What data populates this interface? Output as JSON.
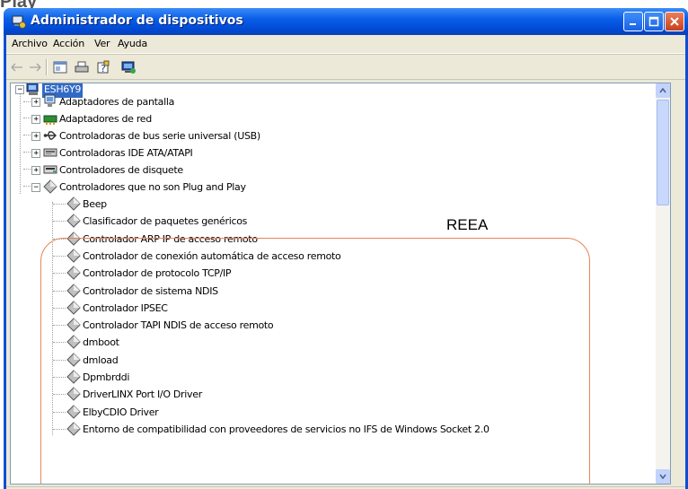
{
  "page": {
    "top_caption": "Play"
  },
  "window": {
    "title": "Administrador de dispositivos"
  },
  "menu": [
    "Archivo",
    "Acción",
    "Ver",
    "Ayuda"
  ],
  "toolbar_icons": [
    "back-icon",
    "forward-icon",
    "properties-icon",
    "print-icon",
    "help-icon",
    "scan-hardware-icon"
  ],
  "annotation": "REEA",
  "tree": {
    "root": "ESH6Y9",
    "categories": [
      {
        "label": "Adaptadores de pantalla",
        "icon": "display-adapter-icon",
        "expander": "+"
      },
      {
        "label": "Adaptadores de red",
        "icon": "network-adapter-icon",
        "expander": "+"
      },
      {
        "label": "Controladoras de bus serie universal (USB)",
        "icon": "usb-icon",
        "expander": "+"
      },
      {
        "label": "Controladoras IDE ATA/ATAPI",
        "icon": "ide-controller-icon",
        "expander": "+"
      },
      {
        "label": "Controladores de disquete",
        "icon": "floppy-controller-icon",
        "expander": "+"
      },
      {
        "label": "Controladores que no son Plug and Play",
        "icon": "non-pnp-driver-icon",
        "expander": "−"
      }
    ],
    "non_pnp_children": [
      "Beep",
      "Clasificador de paquetes genéricos",
      "Controlador ARP IP de acceso remoto",
      "Controlador de conexión automática de acceso remoto",
      "Controlador de protocolo TCP/IP",
      "Controlador de sistema NDIS",
      "Controlador IPSEC",
      "Controlador TAPI NDIS de acceso remoto",
      "dmboot",
      "dmload",
      "Dpmbrddi",
      "DriverLINX Port I/O Driver",
      "ElbyCDIO Driver",
      "Entorno de compatibilidad con proveedores de servicios no IFS de Windows Socket 2.0"
    ]
  },
  "colors": {
    "titlebar": "#0a5ee8",
    "selection": "#316ac5",
    "annotation_oval": "#e8835a",
    "window_frame": "#ece9d8"
  }
}
